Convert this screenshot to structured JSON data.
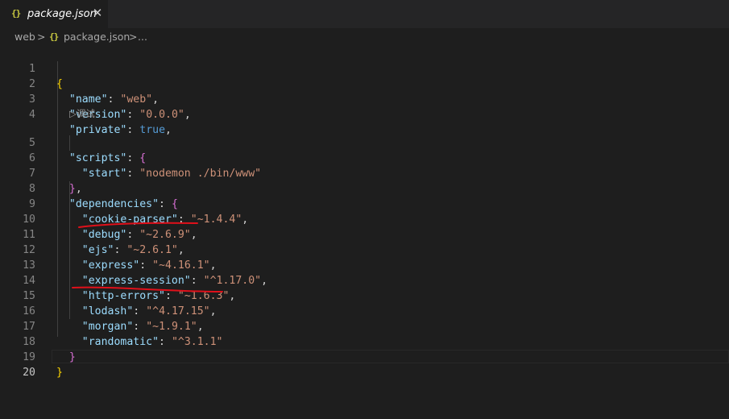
{
  "tab": {
    "icon": "{}",
    "label": "package.json",
    "close_glyph": "✕"
  },
  "breadcrumb": {
    "folder": "web",
    "sep1": ">",
    "file_icon": "{}",
    "file": "package.json",
    "sep2": ">",
    "more": "..."
  },
  "editor": {
    "line_numbers": [
      "1",
      "2",
      "3",
      "4",
      "5",
      "6",
      "7",
      "8",
      "9",
      "10",
      "11",
      "12",
      "13",
      "14",
      "15",
      "16",
      "17",
      "18",
      "19",
      "20"
    ],
    "codelens": "▷调试",
    "lines": {
      "l1": {
        "open": "{"
      },
      "l2": {
        "key": "\"name\"",
        "colon": ": ",
        "value": "\"web\"",
        "comma": ","
      },
      "l3": {
        "key": "\"version\"",
        "colon": ": ",
        "value": "\"0.0.0\"",
        "comma": ","
      },
      "l4": {
        "key": "\"private\"",
        "colon": ": ",
        "value": "true",
        "comma": ","
      },
      "l5": {
        "key": "\"scripts\"",
        "colon": ": ",
        "open": "{"
      },
      "l6": {
        "key": "\"start\"",
        "colon": ": ",
        "value": "\"nodemon ./bin/www\""
      },
      "l7": {
        "close": "}",
        "comma": ","
      },
      "l8": {
        "key": "\"dependencies\"",
        "colon": ": ",
        "open": "{"
      },
      "l9": {
        "key": "\"cookie-parser\"",
        "colon": ": ",
        "value": "\"~1.4.4\"",
        "comma": ","
      },
      "l10": {
        "key": "\"debug\"",
        "colon": ": ",
        "value": "\"~2.6.9\"",
        "comma": ","
      },
      "l11": {
        "key": "\"ejs\"",
        "colon": ": ",
        "value": "\"~2.6.1\"",
        "comma": ","
      },
      "l12": {
        "key": "\"express\"",
        "colon": ": ",
        "value": "\"~4.16.1\"",
        "comma": ","
      },
      "l13": {
        "key": "\"express-session\"",
        "colon": ": ",
        "value": "\"^1.17.0\"",
        "comma": ","
      },
      "l14": {
        "key": "\"http-errors\"",
        "colon": ": ",
        "value": "\"~1.6.3\"",
        "comma": ","
      },
      "l15": {
        "key": "\"lodash\"",
        "colon": ": ",
        "value": "\"^4.17.15\"",
        "comma": ","
      },
      "l16": {
        "key": "\"morgan\"",
        "colon": ": ",
        "value": "\"~1.9.1\"",
        "comma": ","
      },
      "l17": {
        "key": "\"randomatic\"",
        "colon": ": ",
        "value": "\"^3.1.1\""
      },
      "l18": {
        "close": "}"
      },
      "l19": {
        "close": "}"
      },
      "l20": {}
    }
  },
  "colors": {
    "editor_bg": "#1e1e1e",
    "tabbar_bg": "#252526",
    "key": "#9cdcfe",
    "string": "#ce9178",
    "boolean": "#569cd6",
    "bracket_level1": "#ffd700",
    "bracket_level2": "#da70d6",
    "annotation": "#e0101a"
  }
}
